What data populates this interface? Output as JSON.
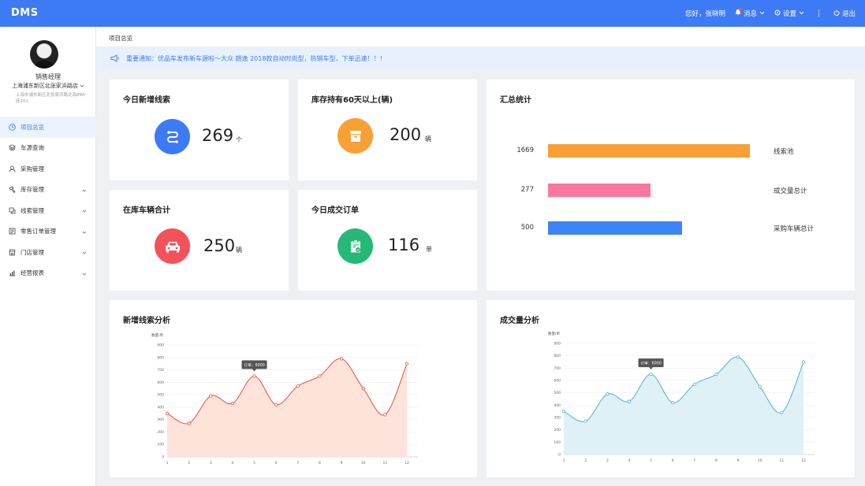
{
  "app": {
    "logo": "DMS"
  },
  "topbar": {
    "greeting": "您好，张晓明",
    "messages": "消息",
    "settings": "设置",
    "logout": "退出"
  },
  "user": {
    "role": "销售经理",
    "store": "上海浦东新区北张家浜路店",
    "address": "上海市浦东新区北张家浜路北海88A座201"
  },
  "sidebar": {
    "items": [
      {
        "label": "项目总览",
        "icon": "dashboard-icon",
        "active": true,
        "expandable": false
      },
      {
        "label": "车源查询",
        "icon": "layers-icon",
        "active": false,
        "expandable": false
      },
      {
        "label": "采购管理",
        "icon": "user-icon",
        "active": false,
        "expandable": false
      },
      {
        "label": "库存管理",
        "icon": "hammer-icon",
        "active": false,
        "expandable": true
      },
      {
        "label": "线索管理",
        "icon": "clue-icon",
        "active": false,
        "expandable": true
      },
      {
        "label": "零售订单管理",
        "icon": "order-icon",
        "active": false,
        "expandable": true
      },
      {
        "label": "门店管理",
        "icon": "store-icon",
        "active": false,
        "expandable": true
      },
      {
        "label": "经营报表",
        "icon": "chart-icon",
        "active": false,
        "expandable": true
      }
    ]
  },
  "breadcrumb": "项目总览",
  "notice": "重要通知：优品车发布新车源啦～大众 朗逸 2018款自动时尚型，热销车型，下单迅速！！！",
  "stats": [
    {
      "title": "今日新增线索",
      "value": "269",
      "unit": "个",
      "color": "#3d7af5",
      "icon": "link-icon"
    },
    {
      "title": "库存持有60天以上(辆)",
      "value": "200",
      "unit": "辆",
      "color": "#f7a035",
      "icon": "archive-icon"
    },
    {
      "title": "在库车辆合计",
      "value": "250",
      "unit": "辆",
      "color": "#f4525b",
      "icon": "car-icon"
    },
    {
      "title": "今日成交订单",
      "value": "116",
      "unit": "单",
      "color": "#26b876",
      "icon": "clipboard-icon"
    }
  ],
  "summary": {
    "title": "汇总统计",
    "rows": [
      {
        "value": 1669,
        "label": "线索池",
        "color": "#f89f35"
      },
      {
        "value": 277,
        "label": "成交量总计",
        "color": "#f7789e"
      },
      {
        "value": 500,
        "label": "采购车辆总计",
        "color": "#3d84f7"
      }
    ]
  },
  "charts": [
    {
      "title": "新增线索分析",
      "chart_data": {
        "type": "area",
        "ylabel": "数量/单",
        "ylim": [
          0,
          900
        ],
        "yticks": [
          0,
          100,
          200,
          300,
          400,
          500,
          600,
          700,
          800,
          900
        ],
        "x": [
          1,
          2,
          3,
          4,
          5,
          6,
          7,
          8,
          9,
          10,
          11,
          12
        ],
        "values": [
          350,
          270,
          490,
          430,
          650,
          420,
          570,
          650,
          790,
          550,
          340,
          750
        ],
        "tooltip": {
          "x": 5,
          "text": "订单：6000"
        },
        "line_color": "#e4513b",
        "fill_color": "#fde3da"
      }
    },
    {
      "title": "成交量分析",
      "chart_data": {
        "type": "area",
        "ylabel": "数量/单",
        "ylim": [
          0,
          900
        ],
        "yticks": [
          0,
          100,
          200,
          300,
          400,
          500,
          600,
          700,
          800,
          900
        ],
        "x": [
          1,
          2,
          3,
          4,
          5,
          6,
          7,
          8,
          9,
          10,
          11,
          12
        ],
        "values": [
          350,
          270,
          490,
          430,
          650,
          420,
          570,
          650,
          790,
          550,
          340,
          750
        ],
        "tooltip": {
          "x": 5,
          "text": "订单：6000"
        },
        "line_color": "#4db2cc",
        "fill_color": "#dff0f6"
      }
    }
  ]
}
